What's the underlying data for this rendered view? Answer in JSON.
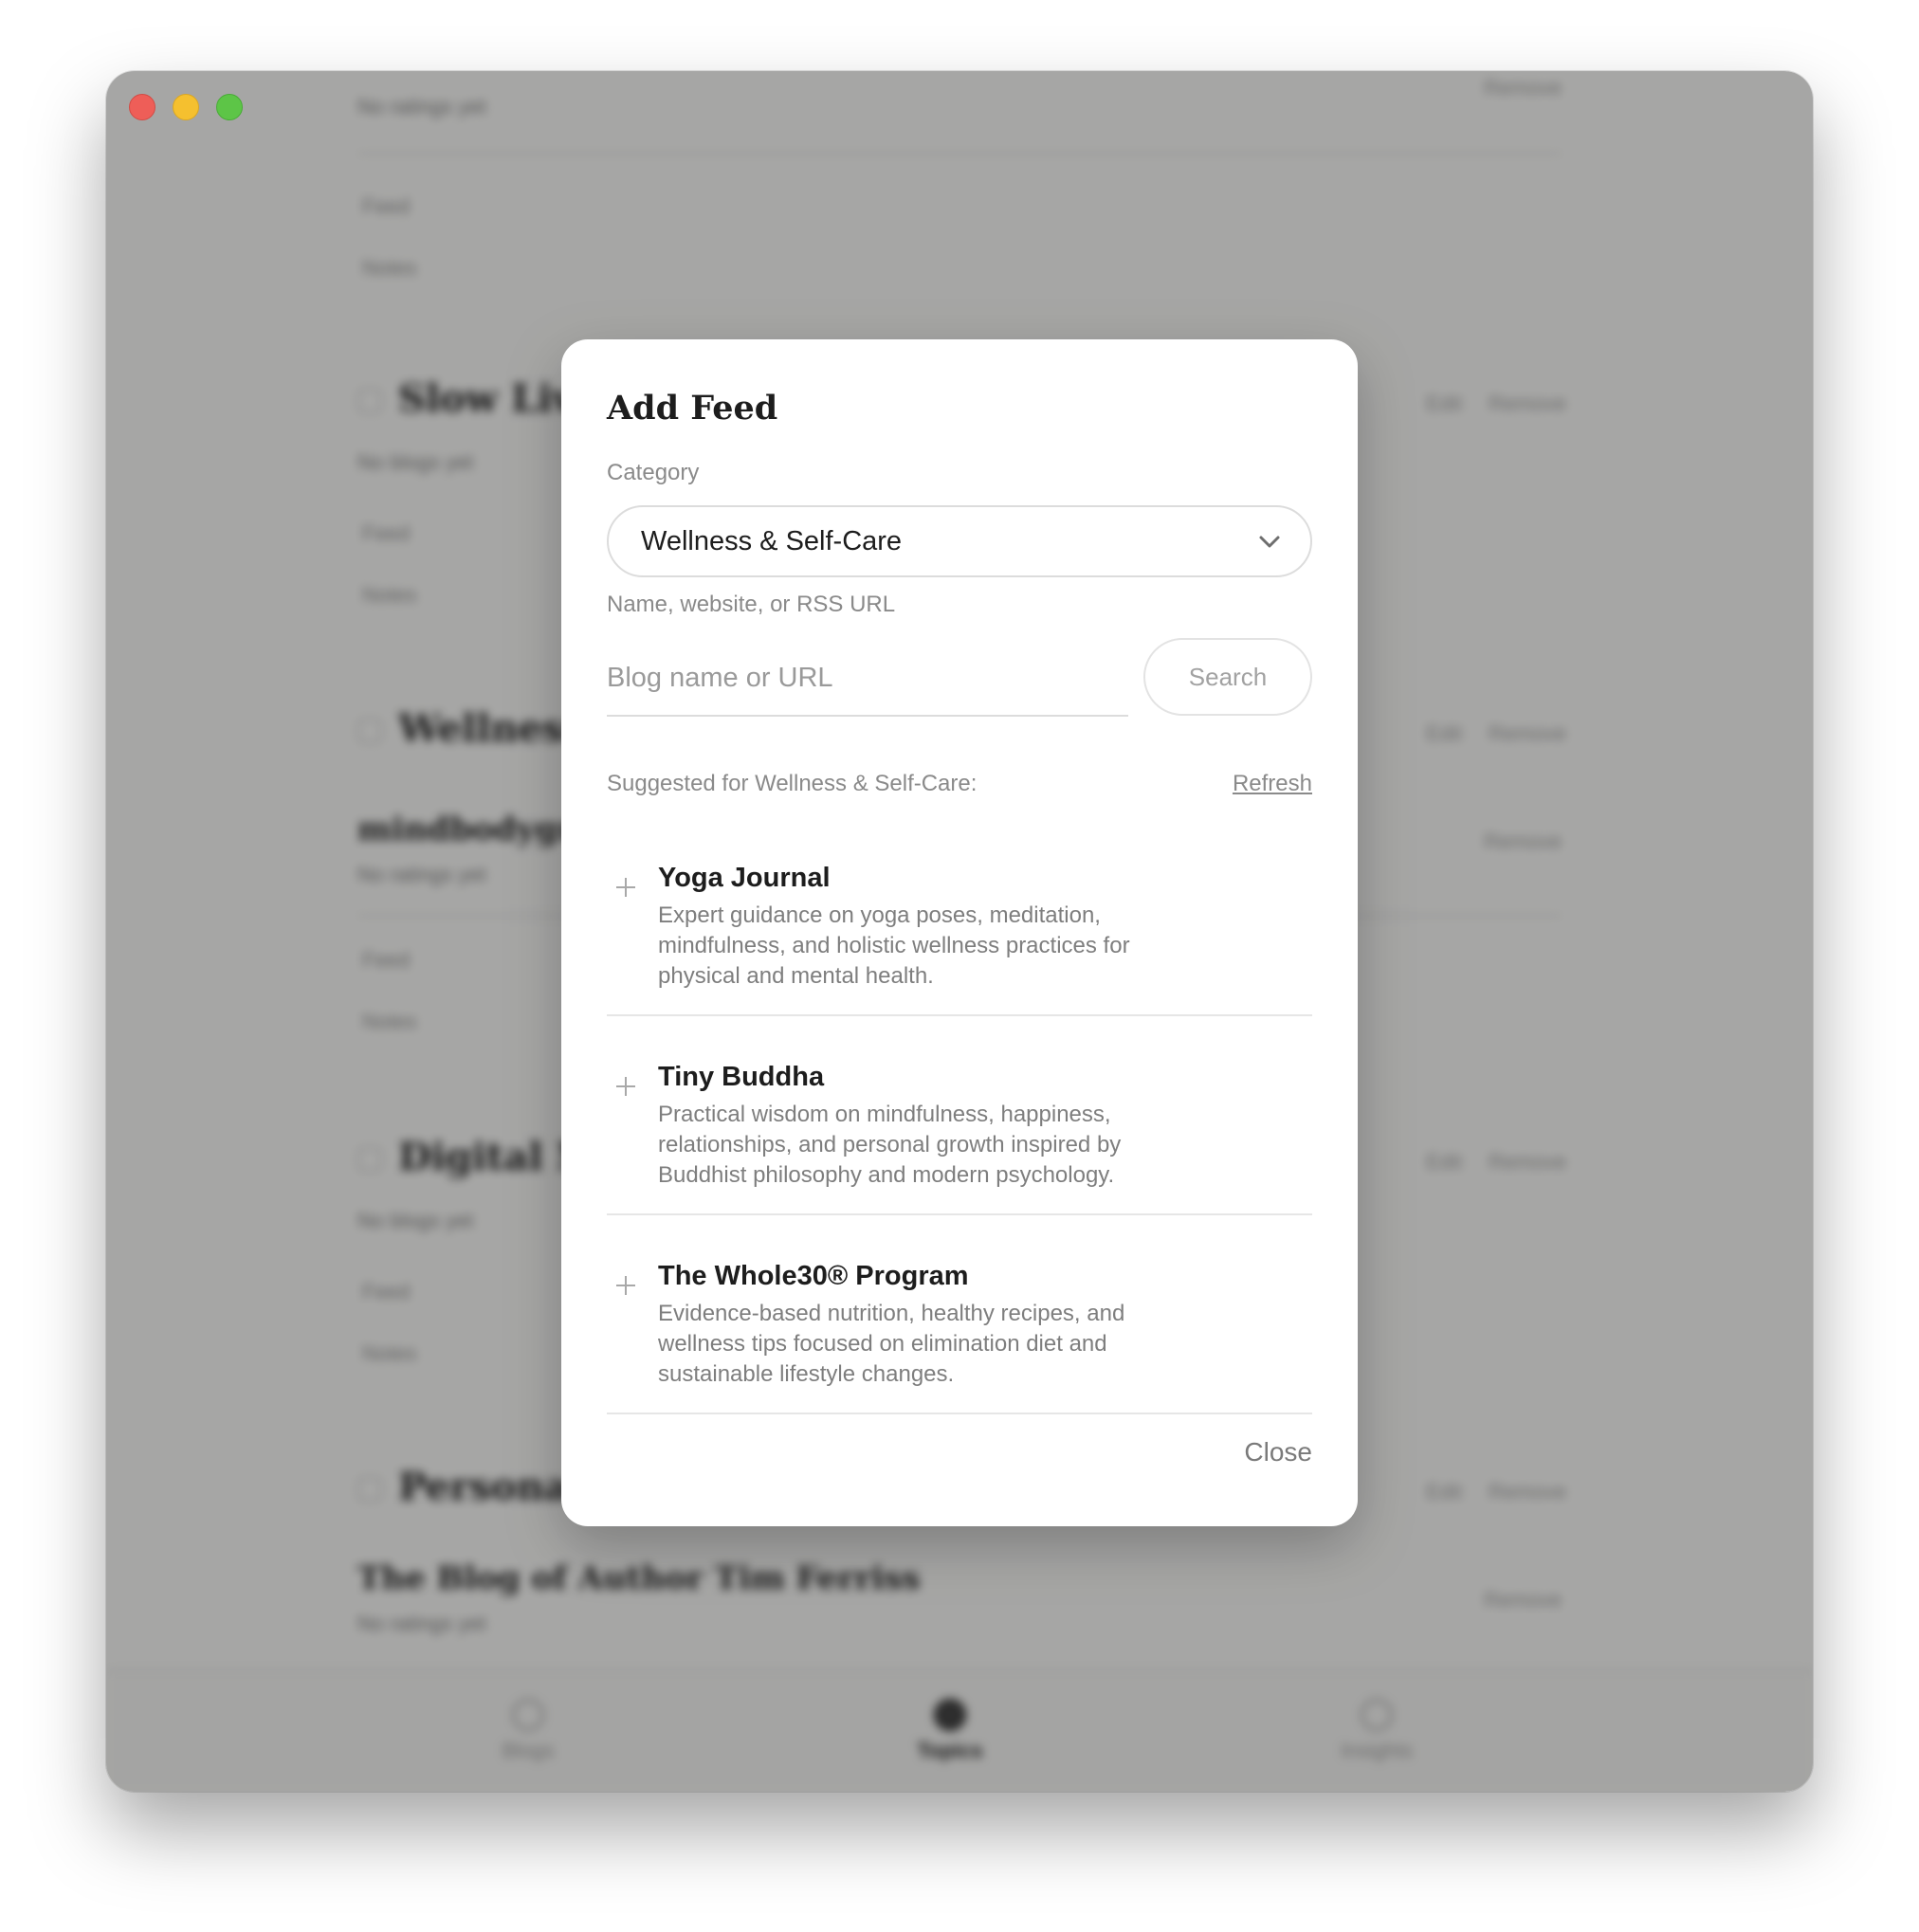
{
  "modal": {
    "title": "Add Feed",
    "category_label": "Category",
    "category_value": "Wellness & Self-Care",
    "url_label": "Name, website, or RSS URL",
    "url_placeholder": "Blog name or URL",
    "url_value": "",
    "search_label": "Search",
    "suggested_label": "Suggested for Wellness & Self-Care:",
    "refresh_label": "Refresh",
    "close_label": "Close",
    "suggestions": [
      {
        "name": "Yoga Journal",
        "description": "Expert guidance on yoga poses, meditation, mindfulness, and holistic wellness practices for physical and mental health."
      },
      {
        "name": "Tiny Buddha",
        "description": "Practical wisdom on mindfulness, happiness, relationships, and personal growth inspired by Buddhist philosophy and modern psychology."
      },
      {
        "name": "The Whole30® Program",
        "description": "Evidence-based nutrition, healthy recipes, and wellness tips focused on elimination diet and sustainable lifestyle changes."
      }
    ]
  },
  "background": {
    "sections": [
      {
        "title": "Slow Livin",
        "sub": "No blogs yet"
      },
      {
        "title": "Wellness &",
        "sub": ""
      },
      {
        "title": "Digital Mi",
        "sub": "No blogs yet"
      },
      {
        "title": "Personal",
        "sub": ""
      }
    ],
    "blogs": [
      {
        "title": "mindbodygreen",
        "sub": "No ratings yet"
      },
      {
        "title": "The Blog of Author Tim Ferriss",
        "sub": "No ratings yet"
      }
    ],
    "links": {
      "feed": "Feed",
      "notes": "Notes",
      "edit": "Edit",
      "remove": "Remove"
    },
    "tabs": [
      "Blogs",
      "Topics",
      "Insights"
    ]
  }
}
